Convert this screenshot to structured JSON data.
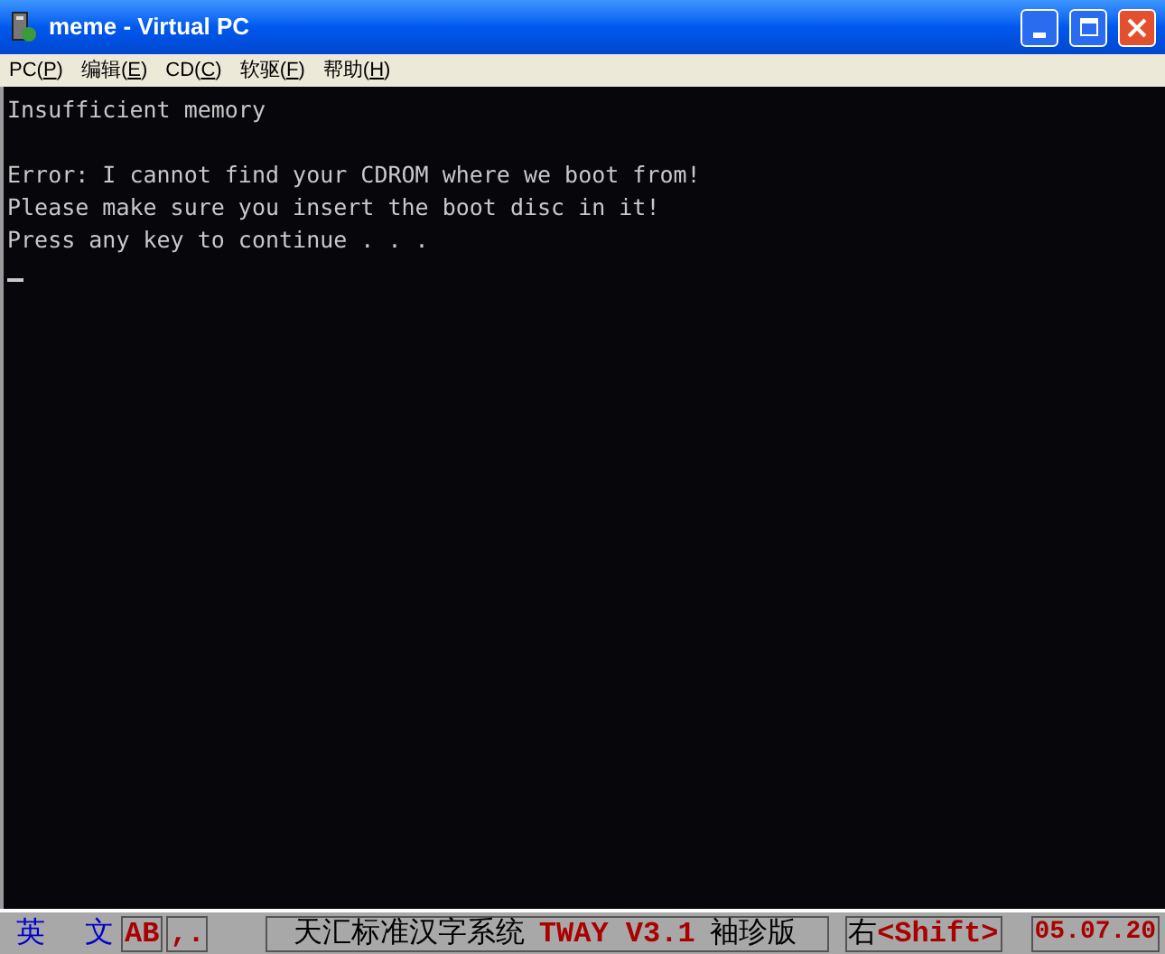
{
  "window": {
    "title": "meme - Virtual PC"
  },
  "menu": [
    {
      "label": "PC(",
      "key": "P",
      "rest": ")"
    },
    {
      "label": "编辑(",
      "key": "E",
      "rest": ")"
    },
    {
      "label": "CD(",
      "key": "C",
      "rest": ")"
    },
    {
      "label": "软驱(",
      "key": "F",
      "rest": ")"
    },
    {
      "label": "帮助(",
      "key": "H",
      "rest": ")"
    }
  ],
  "console": {
    "blocks": [
      [
        "Insufficient memory"
      ],
      [
        "Error: I cannot find your CDROM where we boot from!",
        "Please make sure you insert the boot disc in it!",
        "Press any key to continue . . ."
      ]
    ]
  },
  "status_bar": {
    "mode": [
      {
        "text": "英",
        "color": "#0000cc"
      },
      {
        "text": "文",
        "color": "#0000cc"
      }
    ],
    "keys": [
      {
        "text": "AB",
        "color": "#aa0000"
      },
      {
        "text": ",.",
        "color": "#aa0000"
      }
    ],
    "system": [
      {
        "text": "天汇标准汉字系统",
        "color": "#000000"
      },
      {
        "text": "TWAY V3.1",
        "color": "#aa0000"
      },
      {
        "text": "袖珍版",
        "color": "#000000"
      }
    ],
    "shift": [
      {
        "text": "右",
        "color": "#000000"
      },
      {
        "text": "<Shift>",
        "color": "#aa0000"
      }
    ],
    "date": {
      "text": "05.07.20",
      "color": "#aa0000"
    }
  }
}
